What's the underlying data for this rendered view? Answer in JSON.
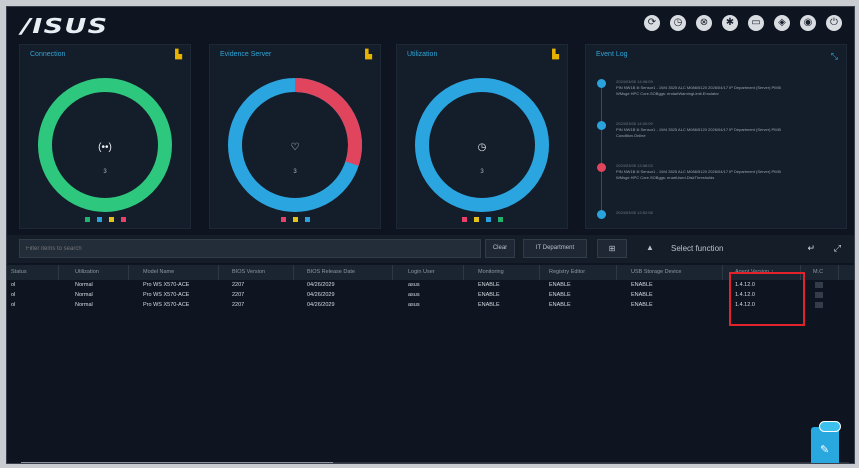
{
  "header": {
    "logo": "/ISUS",
    "icons": [
      "refresh-icon",
      "timer-icon",
      "network-icon",
      "settings-icon",
      "monitor-icon",
      "shield-icon",
      "camera-icon",
      "power-icon"
    ]
  },
  "cards": [
    {
      "title": "Connection",
      "center_icon": "(••)",
      "count": "3",
      "ring_color": "#2ec77e",
      "legend_colors": [
        "#21b36f",
        "#2aa3dc",
        "#e4c21c",
        "#e8406a"
      ]
    },
    {
      "title": "Evidence Server",
      "center_icon": "♡",
      "count": "3",
      "ring_color": "#2ba5df",
      "ring_alert_color": "#e0455d",
      "ring_alert_fraction": 0.3,
      "legend_colors": [
        "#e8406a",
        "#e4c21c",
        "#2aa3dc"
      ]
    },
    {
      "title": "Utilization",
      "center_icon": "◷",
      "count": "3",
      "ring_color": "#2ba5df",
      "legend_colors": [
        "#e8406a",
        "#e4c21c",
        "#2aa3dc",
        "#21b36f"
      ]
    }
  ],
  "event_log": {
    "title": "Event Log",
    "items": [
      {
        "time": "2024/03/05 14:08:09",
        "line1": "PIN NW1B Iii Sensor1 - 1W4 3525 ALC M086/5120 2026/04/17 IP Department (Server) PIM5",
        "line2": "WMsge HPC Core.SOBggs: endartWarningLimit.Emulator",
        "color": "#2aa3dc"
      },
      {
        "time": "2024/03/05 14:00:09",
        "line1": "PIN NW1B Iii Sensor1 - 1W4 3525 ALC M086/5120 2026/04/17 IP Department (Server) PIM5",
        "line2": "Condition.Online",
        "color": "#2aa3dc"
      },
      {
        "time": "2024/03/05 13:58:03",
        "line1": "PIN NW1B Iii Sensor1 - 1W4 3525 ALC M086/5120 2026/04/17 IP Department (Server) PIM5",
        "line2": "WMsge HPC Core.SOBggs: enartUsed.DiskThresholds",
        "color": "#e0455d"
      },
      {
        "time": "2024/03/05 13:52:08",
        "line1": "",
        "line2": "",
        "color": "#2aa3dc"
      }
    ]
  },
  "toolbar": {
    "filter_placeholder": "Filter items to search",
    "clear_label": "Clear",
    "group_label": "IT Department",
    "grid_icon": "grid-icon",
    "upload_icon": "upload-icon",
    "select_function": "Select function"
  },
  "table": {
    "columns": [
      "Status",
      "Utilization",
      "Model Name",
      "BIOS Version",
      "BIOS Release Date",
      "Login User",
      "Monitoring",
      "Registry Editor",
      "USB Storage Device",
      "Agent Version ↑",
      "M.C"
    ],
    "rows": [
      [
        "ol",
        "Normal",
        "Pro WS X570-ACE",
        "2207",
        "04/26/2029",
        "asus",
        "ENABLE",
        "ENABLE",
        "ENABLE",
        "1.4.12.0",
        ""
      ],
      [
        "ol",
        "Normal",
        "Pro WS X570-ACE",
        "2207",
        "04/26/2029",
        "asus",
        "ENABLE",
        "ENABLE",
        "ENABLE",
        "1.4.12.0",
        ""
      ],
      [
        "ol",
        "Normal",
        "Pro WS X570-ACE",
        "2207",
        "04/26/2029",
        "asus",
        "ENABLE",
        "ENABLE",
        "ENABLE",
        "1.4.12.0",
        ""
      ]
    ]
  },
  "chat": {
    "badge": "",
    "icon": "chat-icon"
  }
}
